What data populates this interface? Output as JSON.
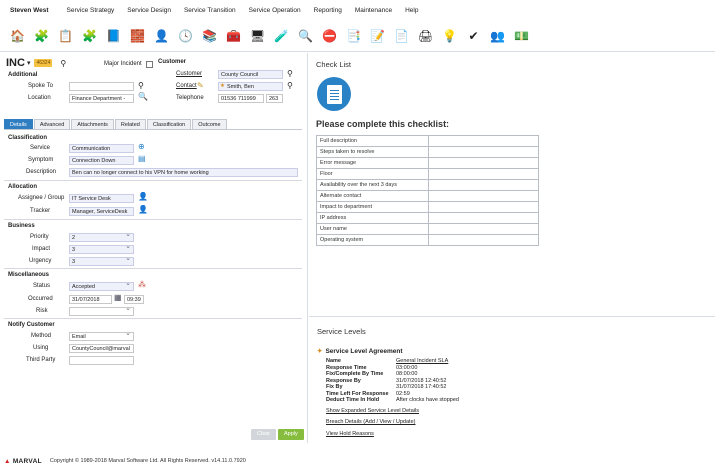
{
  "menu": {
    "user": "Steven West",
    "items": [
      "Service Strategy",
      "Service Design",
      "Service Transition",
      "Service Operation",
      "Reporting",
      "Maintenance",
      "Help"
    ]
  },
  "toolbar_icons": [
    {
      "name": "home-icon",
      "glyph": "🏠"
    },
    {
      "name": "incident-icon",
      "glyph": "🧩"
    },
    {
      "name": "form-icon",
      "glyph": "📋"
    },
    {
      "name": "puzzle-icon",
      "glyph": "🧩"
    },
    {
      "name": "book-icon",
      "glyph": "📘"
    },
    {
      "name": "blocks-icon",
      "glyph": "🧱"
    },
    {
      "name": "user-service-icon",
      "glyph": "👤"
    },
    {
      "name": "clock-icon",
      "glyph": "🕓"
    },
    {
      "name": "knowledge-icon",
      "glyph": "📚"
    },
    {
      "name": "toolbox-icon",
      "glyph": "🧰"
    },
    {
      "name": "monitor-icon",
      "glyph": "🖥"
    },
    {
      "name": "bottles-icon",
      "glyph": "🧪"
    },
    {
      "name": "search-doc-icon",
      "glyph": "🔍"
    },
    {
      "name": "alert-icon",
      "glyph": "⛔"
    },
    {
      "name": "copy-icon",
      "glyph": "📑"
    },
    {
      "name": "notes-icon",
      "glyph": "📝"
    },
    {
      "name": "document-icon",
      "glyph": "📄"
    },
    {
      "name": "printer-icon",
      "glyph": "🖨"
    },
    {
      "name": "idea-icon",
      "glyph": "💡"
    },
    {
      "name": "checkmark-icon",
      "glyph": "✔"
    },
    {
      "name": "people-icon",
      "glyph": "👥"
    },
    {
      "name": "money-icon",
      "glyph": "💵"
    }
  ],
  "incident": {
    "title": "INC",
    "number": "46324",
    "major_incident_label": "Major Incident",
    "additional_label": "Additional",
    "customer_label": "Customer",
    "spoke_to_label": "Spoke To",
    "location_label": "Location",
    "location_value": "Finance Department -",
    "customer_field_label": "Customer",
    "customer_value": "County Council",
    "contact_label": "Contact",
    "contact_value": "Smith, Ben",
    "telephone_label": "Telephone",
    "telephone_value": "01536 711999",
    "extension_value": "263"
  },
  "tabs": [
    "Details",
    "Advanced",
    "Attachments",
    "Related",
    "Classification",
    "Outcome"
  ],
  "classification": {
    "heading": "Classification",
    "service_label": "Service",
    "service_value": "Communication",
    "symptom_label": "Symptom",
    "symptom_value": "Connection Down",
    "description_label": "Description",
    "description_value": "Ben can no longer connect to his VPN for home working"
  },
  "allocation": {
    "heading": "Allocation",
    "assignee_label": "Assignee / Group",
    "assignee_value": "IT Service Desk",
    "tracker_label": "Tracker",
    "tracker_value": "Manager, ServiceDesk"
  },
  "business": {
    "heading": "Business",
    "priority_label": "Priority",
    "priority_value": "2",
    "impact_label": "Impact",
    "impact_value": "3",
    "urgency_label": "Urgency",
    "urgency_value": "3"
  },
  "misc": {
    "heading": "Miscellaneous",
    "status_label": "Status",
    "status_value": "Accepted",
    "occurred_label": "Occurred",
    "occurred_date": "31/07/2018",
    "occurred_time": "09:39",
    "risk_label": "Risk",
    "risk_value": ""
  },
  "notify": {
    "heading": "Notify Customer",
    "method_label": "Method",
    "method_value": "Email",
    "using_label": "Using",
    "using_value": "CountyCouncil@marval",
    "third_party_label": "Third Party",
    "third_party_value": ""
  },
  "buttons": {
    "clear": "Clear",
    "apply": "Apply"
  },
  "checklist": {
    "panel_title": "Check List",
    "heading": "Please complete this checklist:",
    "items": [
      "Full description",
      "Steps taken to resolve",
      "Error message",
      "Floor",
      "Availability over the next 3 days",
      "Alternate contact",
      "Impact to department",
      "IP address",
      "User name",
      "Operating system"
    ]
  },
  "service_levels": {
    "panel_title": "Service Levels",
    "sla_title": "Service Level Agreement",
    "rows": [
      {
        "k": "Name",
        "v": "General Incident SLA",
        "link": true
      },
      {
        "k": "Response Time",
        "v": "03:00:00",
        "link": false
      },
      {
        "k": "Fix/Complete By Time",
        "v": "08:00:00",
        "link": false
      },
      {
        "k": "Response By",
        "v": "31/07/2018 12:40:52",
        "link": false
      },
      {
        "k": "Fix By",
        "v": "31/07/2018 17:40:52",
        "link": false
      },
      {
        "k": "Time Left For Response",
        "v": "02:59",
        "link": false
      },
      {
        "k": "Deduct Time In Hold",
        "v": "After clocks have stopped",
        "link": false
      }
    ],
    "links": [
      "Show Expanded Service Level Details",
      "Breach Details (Add / View / Update)",
      "View Hold Reasons"
    ]
  },
  "footer": {
    "logo": "MARVAL",
    "copyright": "Copyright © 1989-2018 Marval Software Ltd. All Rights Reserved. v14.11.0.7920"
  }
}
